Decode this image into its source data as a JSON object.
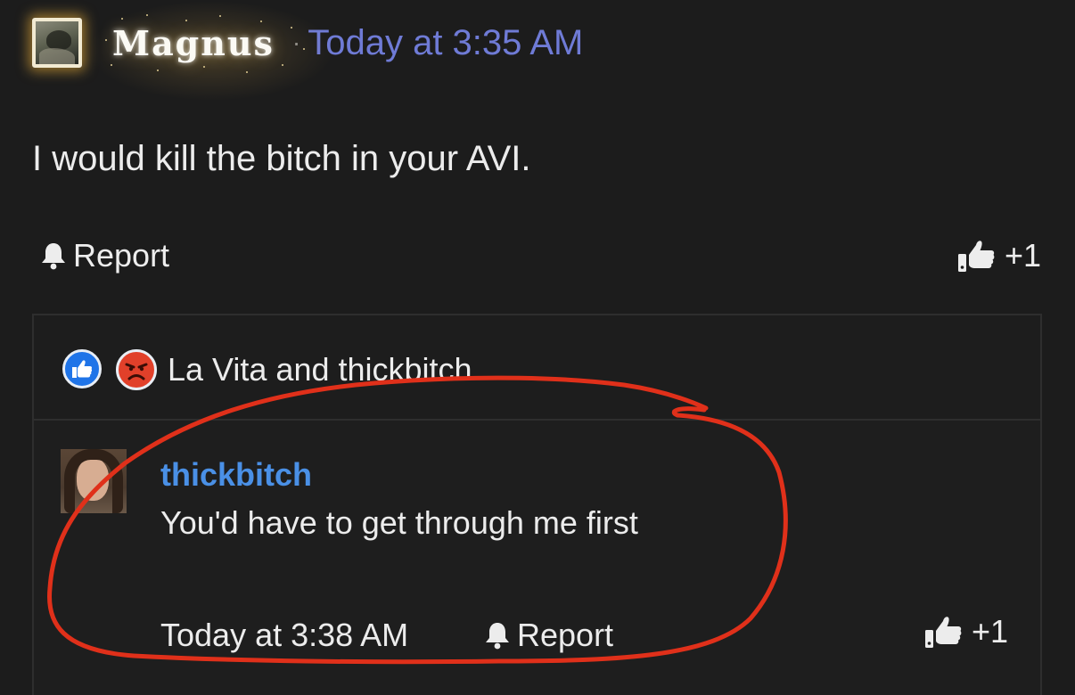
{
  "post": {
    "author": "Magnus",
    "separator": "·",
    "timestamp": "Today at 3:35 AM",
    "body": "I would kill the bitch in your AVI.",
    "report_label": "Report",
    "like_count": "+1"
  },
  "reactions": {
    "icons": [
      "like-reaction-icon",
      "angry-reaction-icon"
    ],
    "reactors": "La Vita and thickbitch"
  },
  "reply": {
    "author": "thickbitch",
    "body": "You'd have to get through me first",
    "timestamp": "Today at 3:38 AM",
    "report_label": "Report",
    "like_count": "+1"
  },
  "colors": {
    "background": "#1c1c1c",
    "timestamp_link": "#6f7bd6",
    "username_link": "#4a90e6",
    "annotation_stroke": "#e0301a",
    "like_reaction": "#1f74e8",
    "angry_reaction": "#e1402a"
  }
}
